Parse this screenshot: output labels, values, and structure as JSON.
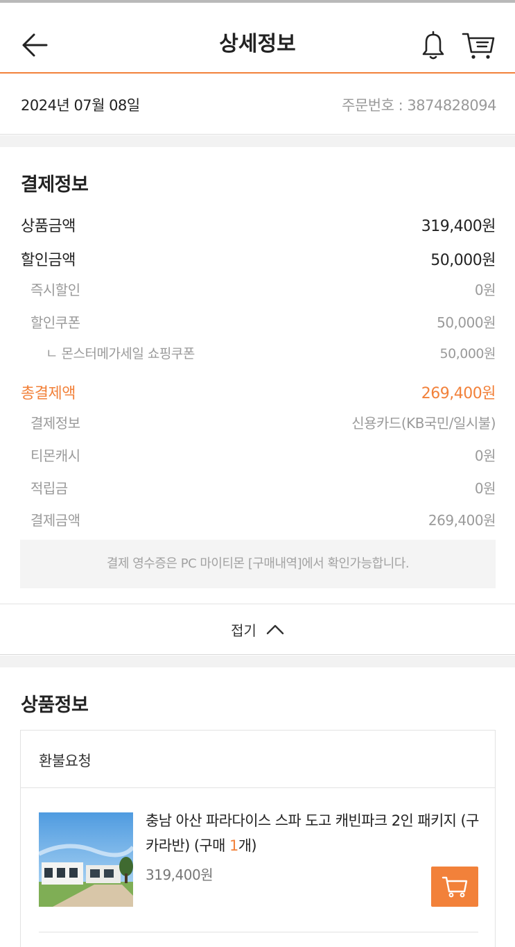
{
  "header": {
    "title": "상세정보",
    "back_icon": "arrow-left-icon",
    "bell_icon": "bell-icon",
    "cart_icon": "cart-icon"
  },
  "order": {
    "date": "2024년 07월 08일",
    "number": "주문번호 : 3874828094"
  },
  "payment": {
    "title": "결제정보",
    "product_amount_label": "상품금액",
    "product_amount_value": "319,400원",
    "discount_label": "할인금액",
    "discount_value": "50,000원",
    "instant_discount_label": "즉시할인",
    "instant_discount_value": "0원",
    "coupon_discount_label": "할인쿠폰",
    "coupon_discount_value": "50,000원",
    "coupon_detail_label": "ㄴ 몬스터메가세일 쇼핑쿠폰",
    "coupon_detail_value": "50,000원",
    "total_label": "총결제액",
    "total_value": "269,400원",
    "method_label": "결제정보",
    "method_value": "신용카드(KB국민/일시불)",
    "tmon_cash_label": "티몬캐시",
    "tmon_cash_value": "0원",
    "points_label": "적립금",
    "points_value": "0원",
    "paid_label": "결제금액",
    "paid_value": "269,400원",
    "notice": "결제 영수증은 PC 마이티몬 [구매내역]에서 확인가능합니다."
  },
  "collapse": {
    "label": "접기",
    "icon": "chevron-up-icon"
  },
  "product": {
    "title": "상품정보",
    "refund_label": "환불요청",
    "name_main": "충남 아산 파라다이스 스파 도고 캐빈파크 2인 패키지 (구 카라반) (구매 ",
    "quantity": "1",
    "name_suffix": "개)",
    "price": "319,400원",
    "cart_button_icon": "cart-icon"
  },
  "colors": {
    "accent": "#f2813a",
    "muted_text": "#9a9a9a",
    "section_gap": "#f2f2f2"
  }
}
